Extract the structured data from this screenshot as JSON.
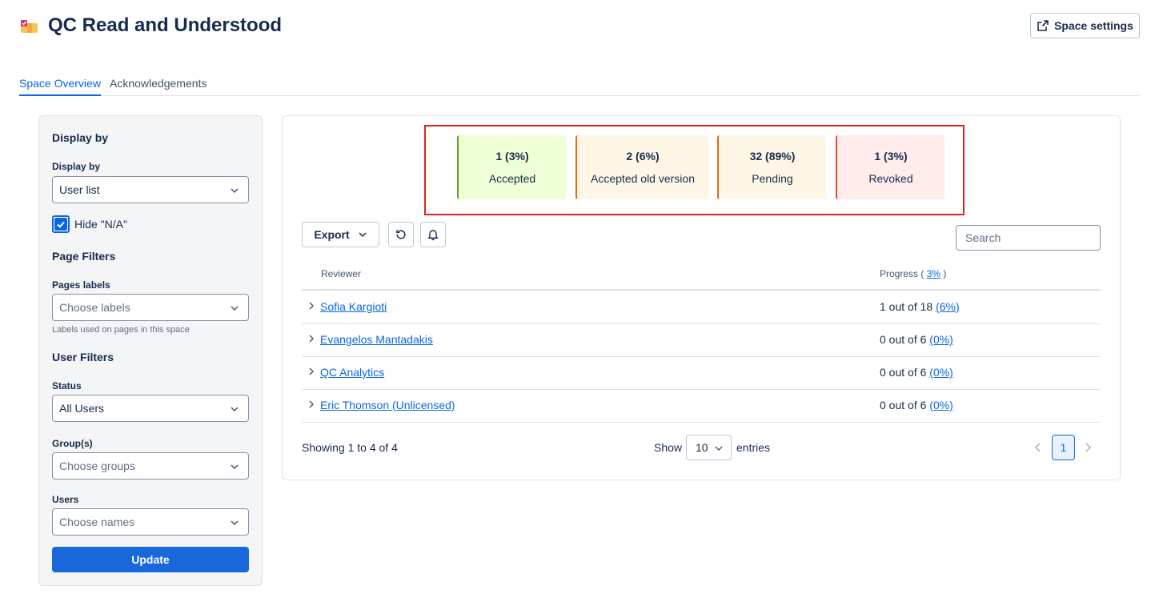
{
  "header": {
    "title": "QC Read and Understood",
    "space_settings_label": "Space settings"
  },
  "tabs": [
    {
      "label": "Space Overview",
      "active": true
    },
    {
      "label": "Acknowledgements",
      "active": false
    }
  ],
  "sidebar": {
    "display_heading": "Display by",
    "display_by_label": "Display by",
    "display_by_value": "User list",
    "hide_na_label": "Hide \"N/A\"",
    "hide_na_checked": true,
    "page_filters_heading": "Page Filters",
    "pages_labels_label": "Pages labels",
    "pages_labels_placeholder": "Choose labels",
    "pages_labels_help": "Labels used on pages in this space",
    "user_filters_heading": "User Filters",
    "status_label": "Status",
    "status_value": "All Users",
    "groups_label": "Group(s)",
    "groups_placeholder": "Choose groups",
    "users_label": "Users",
    "users_placeholder": "Choose names",
    "update_label": "Update"
  },
  "stats": [
    {
      "value": "1 (3%)",
      "label": "Accepted",
      "bg": "#efffd6",
      "border": "#6a9a23"
    },
    {
      "value": "2 (6%)",
      "label": "Accepted old version",
      "bg": "#fff7e6",
      "border": "#e56910"
    },
    {
      "value": "32 (89%)",
      "label": "Pending",
      "bg": "#fff7e6",
      "border": "#e56910"
    },
    {
      "value": "1 (3%)",
      "label": "Revoked",
      "bg": "#ffeceb",
      "border": "#e2483d"
    }
  ],
  "toolbar": {
    "export_label": "Export",
    "search_placeholder": "Search"
  },
  "table": {
    "col_reviewer": "Reviewer",
    "col_progress_prefix": "Progress (",
    "col_progress_pct": "3%",
    "col_progress_suffix": ")",
    "rows": [
      {
        "name": "Sofia Kargioti",
        "progress": "1 out of 18",
        "pct": "(6%)"
      },
      {
        "name": "Evangelos Mantadakis",
        "progress": "0 out of 6",
        "pct": "(0%)"
      },
      {
        "name": "QC Analytics",
        "progress": "0 out of 6",
        "pct": "(0%)"
      },
      {
        "name": "Eric Thomson (Unlicensed)",
        "progress": "0 out of 6",
        "pct": "(0%)"
      }
    ]
  },
  "footer": {
    "showing": "Showing 1 to 4 of 4",
    "show_label": "Show",
    "entries_value": "10",
    "entries_label": "entries",
    "current_page": "1"
  },
  "colors": {
    "accent": "#0c66e4",
    "highlight": "#e02020"
  }
}
